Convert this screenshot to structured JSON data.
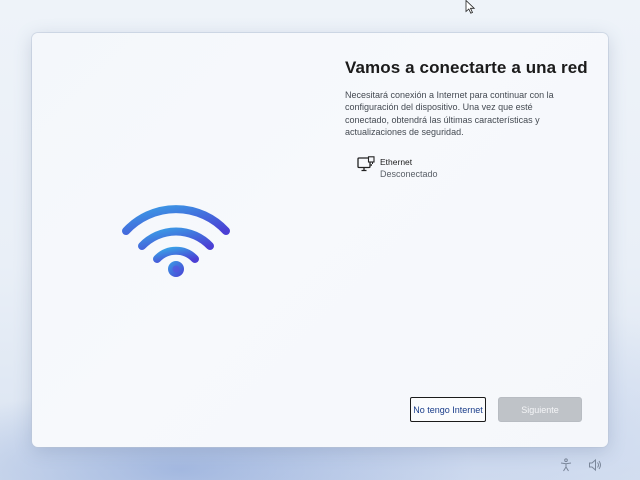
{
  "page": {
    "title": "Vamos a conectarte a una red",
    "description": "Necesitará conexión a Internet para continuar con la configuración del dispositivo. Una vez que esté conectado, obtendrá las últimas características y actualizaciones de seguridad."
  },
  "network": {
    "icon": "ethernet-icon",
    "name": "Ethernet",
    "status": "Desconectado"
  },
  "buttons": {
    "no_internet": "No tengo Internet",
    "next": "Siguiente"
  },
  "illustration": {
    "icon": "wifi-icon"
  },
  "taskbar": {
    "icons": [
      "accessibility-icon",
      "volume-icon"
    ]
  },
  "colors": {
    "accent": "#3b6fdc",
    "accent_dark": "#2a4fc7",
    "wifi_gradient_start": "#3aa0e8",
    "wifi_gradient_end": "#4a3fd6"
  }
}
